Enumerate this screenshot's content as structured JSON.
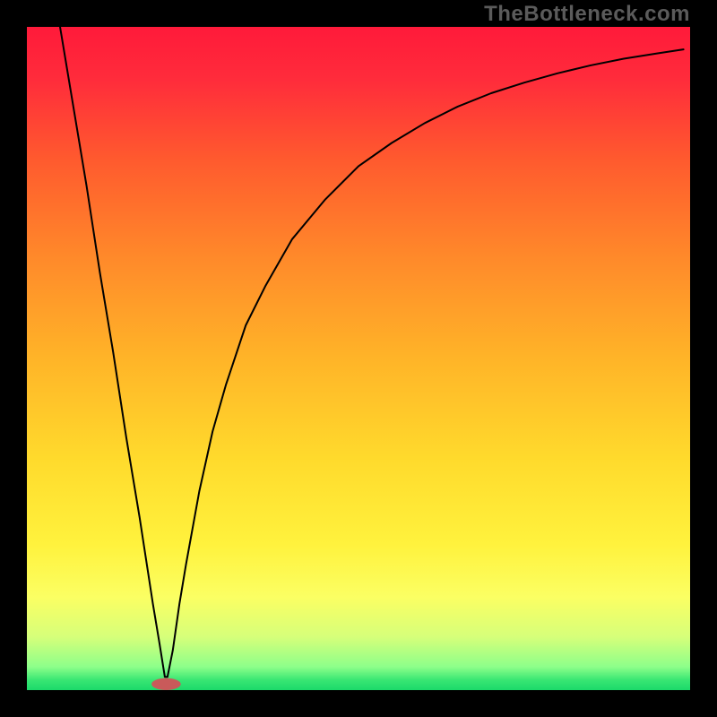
{
  "watermark": "TheBottleneck.com",
  "chart_data": {
    "type": "line",
    "title": "",
    "xlabel": "",
    "ylabel": "",
    "xlim": [
      0,
      100
    ],
    "ylim": [
      0,
      100
    ],
    "grid": false,
    "legend": false,
    "annotations": [],
    "background_gradient": {
      "stops": [
        {
          "offset": 0.0,
          "color": "#ff1a3a"
        },
        {
          "offset": 0.08,
          "color": "#ff2c3b"
        },
        {
          "offset": 0.2,
          "color": "#ff5a2e"
        },
        {
          "offset": 0.35,
          "color": "#ff8a2a"
        },
        {
          "offset": 0.5,
          "color": "#ffb428"
        },
        {
          "offset": 0.65,
          "color": "#ffda2c"
        },
        {
          "offset": 0.78,
          "color": "#fff23d"
        },
        {
          "offset": 0.86,
          "color": "#fbff63"
        },
        {
          "offset": 0.92,
          "color": "#d6ff7a"
        },
        {
          "offset": 0.965,
          "color": "#8dff8a"
        },
        {
          "offset": 0.985,
          "color": "#38e673"
        },
        {
          "offset": 1.0,
          "color": "#1bd96a"
        }
      ]
    },
    "series": [
      {
        "name": "curve",
        "stroke": "#000000",
        "stroke_width": 2,
        "x": [
          5,
          7,
          9,
          11,
          13,
          15,
          17,
          19,
          20,
          20.8,
          21.2,
          22,
          23,
          24,
          26,
          28,
          30,
          33,
          36,
          40,
          45,
          50,
          55,
          60,
          65,
          70,
          75,
          80,
          85,
          90,
          95,
          99
        ],
        "y": [
          100,
          88,
          76,
          63,
          51,
          38,
          26,
          13,
          7,
          2,
          2,
          6,
          13,
          19,
          30,
          39,
          46,
          55,
          61,
          68,
          74,
          79,
          82.5,
          85.5,
          88,
          90,
          91.6,
          93,
          94.2,
          95.2,
          96,
          96.6
        ]
      }
    ],
    "marker": {
      "name": "vertex-marker",
      "shape": "pill",
      "fill": "#c95a5a",
      "cx": 21,
      "cy": 0.9,
      "rx": 2.2,
      "ry": 0.9
    }
  }
}
